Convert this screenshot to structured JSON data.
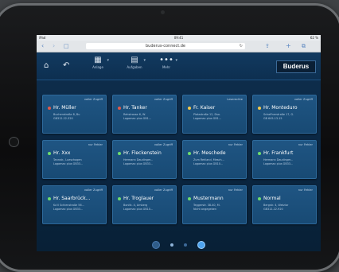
{
  "status_bar": {
    "left": "iPad",
    "time": "09:41",
    "right": "62 %"
  },
  "browser": {
    "url": "buderus-connect.de"
  },
  "header": {
    "nav": [
      {
        "label": "Anlage"
      },
      {
        "label": "Aufgaben"
      },
      {
        "label": "Mehr"
      }
    ],
    "logo": "Buderus"
  },
  "tiles": [
    {
      "name": "Hr. Müller",
      "status": "voller Zugriff",
      "line1": "Buchenstraße 8, Bu",
      "line2": "GB312-22-320",
      "color": "#e05a4a"
    },
    {
      "name": "Hr. Tanker",
      "status": "voller Zugriff",
      "line1": "Rehstrasse 6, W.",
      "line2": "Logamax plus GB1...",
      "color": "#e05a4a"
    },
    {
      "name": "Fr. Kaiser",
      "status": "Leserechte",
      "line1": "Platzstraße 12, Dso.",
      "line2": "Logamax plus GB1...",
      "color": "#f2c94c"
    },
    {
      "name": "Hr. Monteduro",
      "status": "voller Zugriff",
      "line1": "Schaffnerstraße 17, G.",
      "line2": "GB 645-13-15",
      "color": "#f2c94c"
    },
    {
      "name": "Hr. Xxx",
      "status": "nur Fehler",
      "line1": "Tannstr., Lueschagen",
      "line2": "Logamax plus GB33...",
      "color": "#6ddc6d"
    },
    {
      "name": "Hr. Fleckenstein",
      "status": "voller Zugriff",
      "line1": "Hermann Daudinger...",
      "line2": "Logamax plus GB33...",
      "color": "#6ddc6d"
    },
    {
      "name": "Hr. Meschede",
      "status": "nur Fehler",
      "line1": "Zum Rehland, Mesch...",
      "line2": "Logamax plus GB10...",
      "color": "#6ddc6d"
    },
    {
      "name": "Hr. Frankfurt",
      "status": "nur Fehler",
      "line1": "Hermann Daudinger...",
      "line2": "Logamax plus GB33...",
      "color": "#6ddc6d"
    },
    {
      "name": "Hr. Saarbrück...",
      "status": "voller Zugriff",
      "line1": "Ku'il Schienstraße 56...",
      "line2": "Logamax plus GB33...",
      "color": "#6ddc6d"
    },
    {
      "name": "Hr. Troglauer",
      "status": "voller Zugriff",
      "line1": "Bonifz. 4, Amberg",
      "line2": "Logamax plus GB10...",
      "color": "#6ddc6d"
    },
    {
      "name": "Mustermann",
      "status": "nur Fehler",
      "line1": "Teggerstr. 38-40, M.",
      "line2": "Nicht angegeben",
      "color": "#6ddc6d"
    },
    {
      "name": "Normal",
      "status": "nur Fehler",
      "line1": "Bergstr. 4, Wetzlar",
      "line2": "GB312-22-920",
      "color": "#6ddc6d"
    }
  ]
}
